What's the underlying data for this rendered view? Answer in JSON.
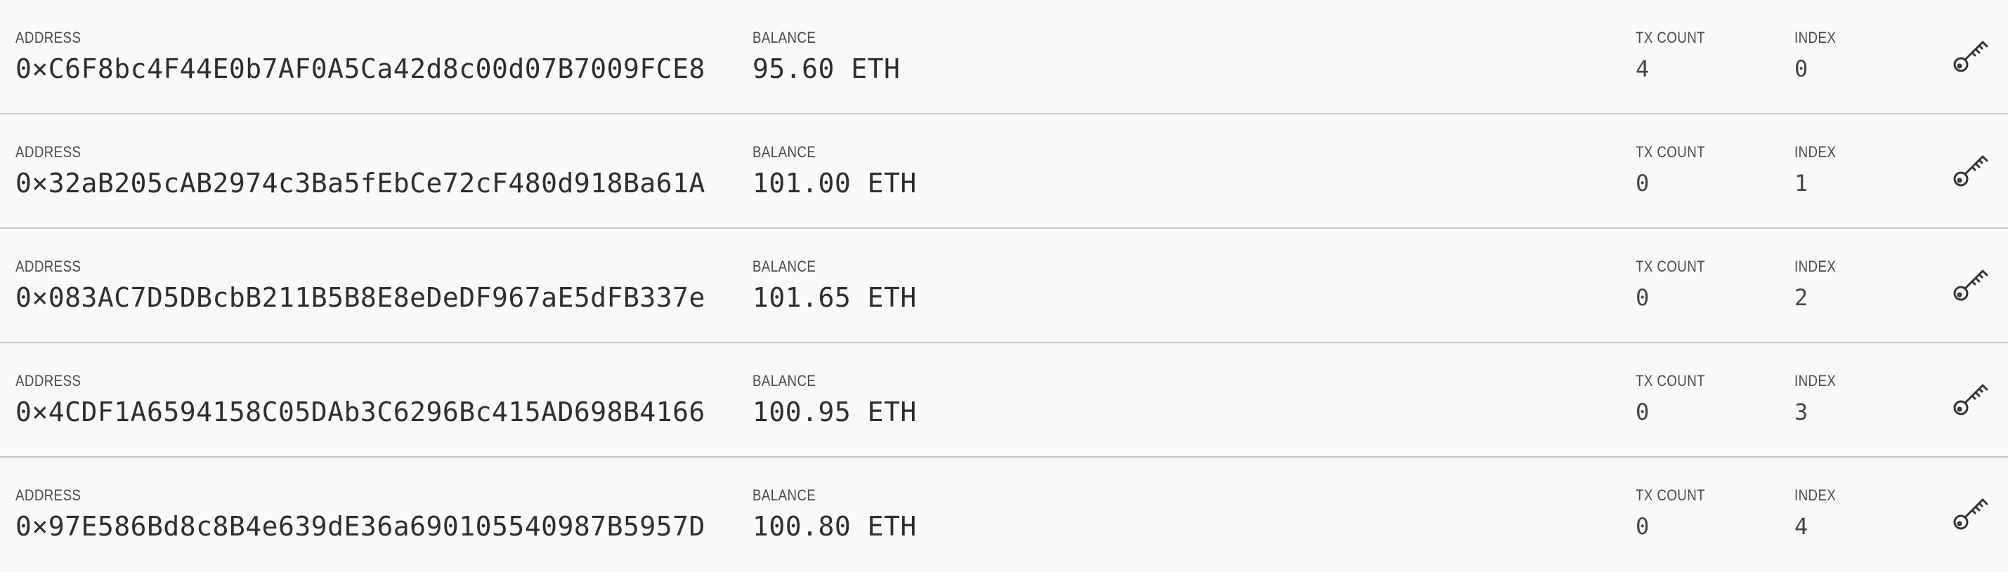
{
  "labels": {
    "address": "ADDRESS",
    "balance": "BALANCE",
    "tx_count": "TX COUNT",
    "index": "INDEX"
  },
  "accounts": [
    {
      "address": "0×C6F8bc4F44E0b7AF0A5Ca42d8c00d07B7009FCE8",
      "balance": "95.60 ETH",
      "tx_count": "4",
      "index": "0"
    },
    {
      "address": "0×32aB205cAB2974c3Ba5fEbCe72cF480d918Ba61A",
      "balance": "101.00 ETH",
      "tx_count": "0",
      "index": "1"
    },
    {
      "address": "0×083AC7D5DBcbB211B5B8E8eDeDF967aE5dFB337e",
      "balance": "101.65 ETH",
      "tx_count": "0",
      "index": "2"
    },
    {
      "address": "0×4CDF1A6594158C05DAb3C6296Bc415AD698B4166",
      "balance": "100.95 ETH",
      "tx_count": "0",
      "index": "3"
    },
    {
      "address": "0×97E586Bd8c8B4e639dE36a690105540987B5957D",
      "balance": "100.80 ETH",
      "tx_count": "0",
      "index": "4"
    }
  ],
  "icons": {
    "key": "key-icon"
  },
  "colors": {
    "background": "#f9f9f8",
    "divider": "#c8c8c8",
    "text": "#2e2e2e"
  }
}
